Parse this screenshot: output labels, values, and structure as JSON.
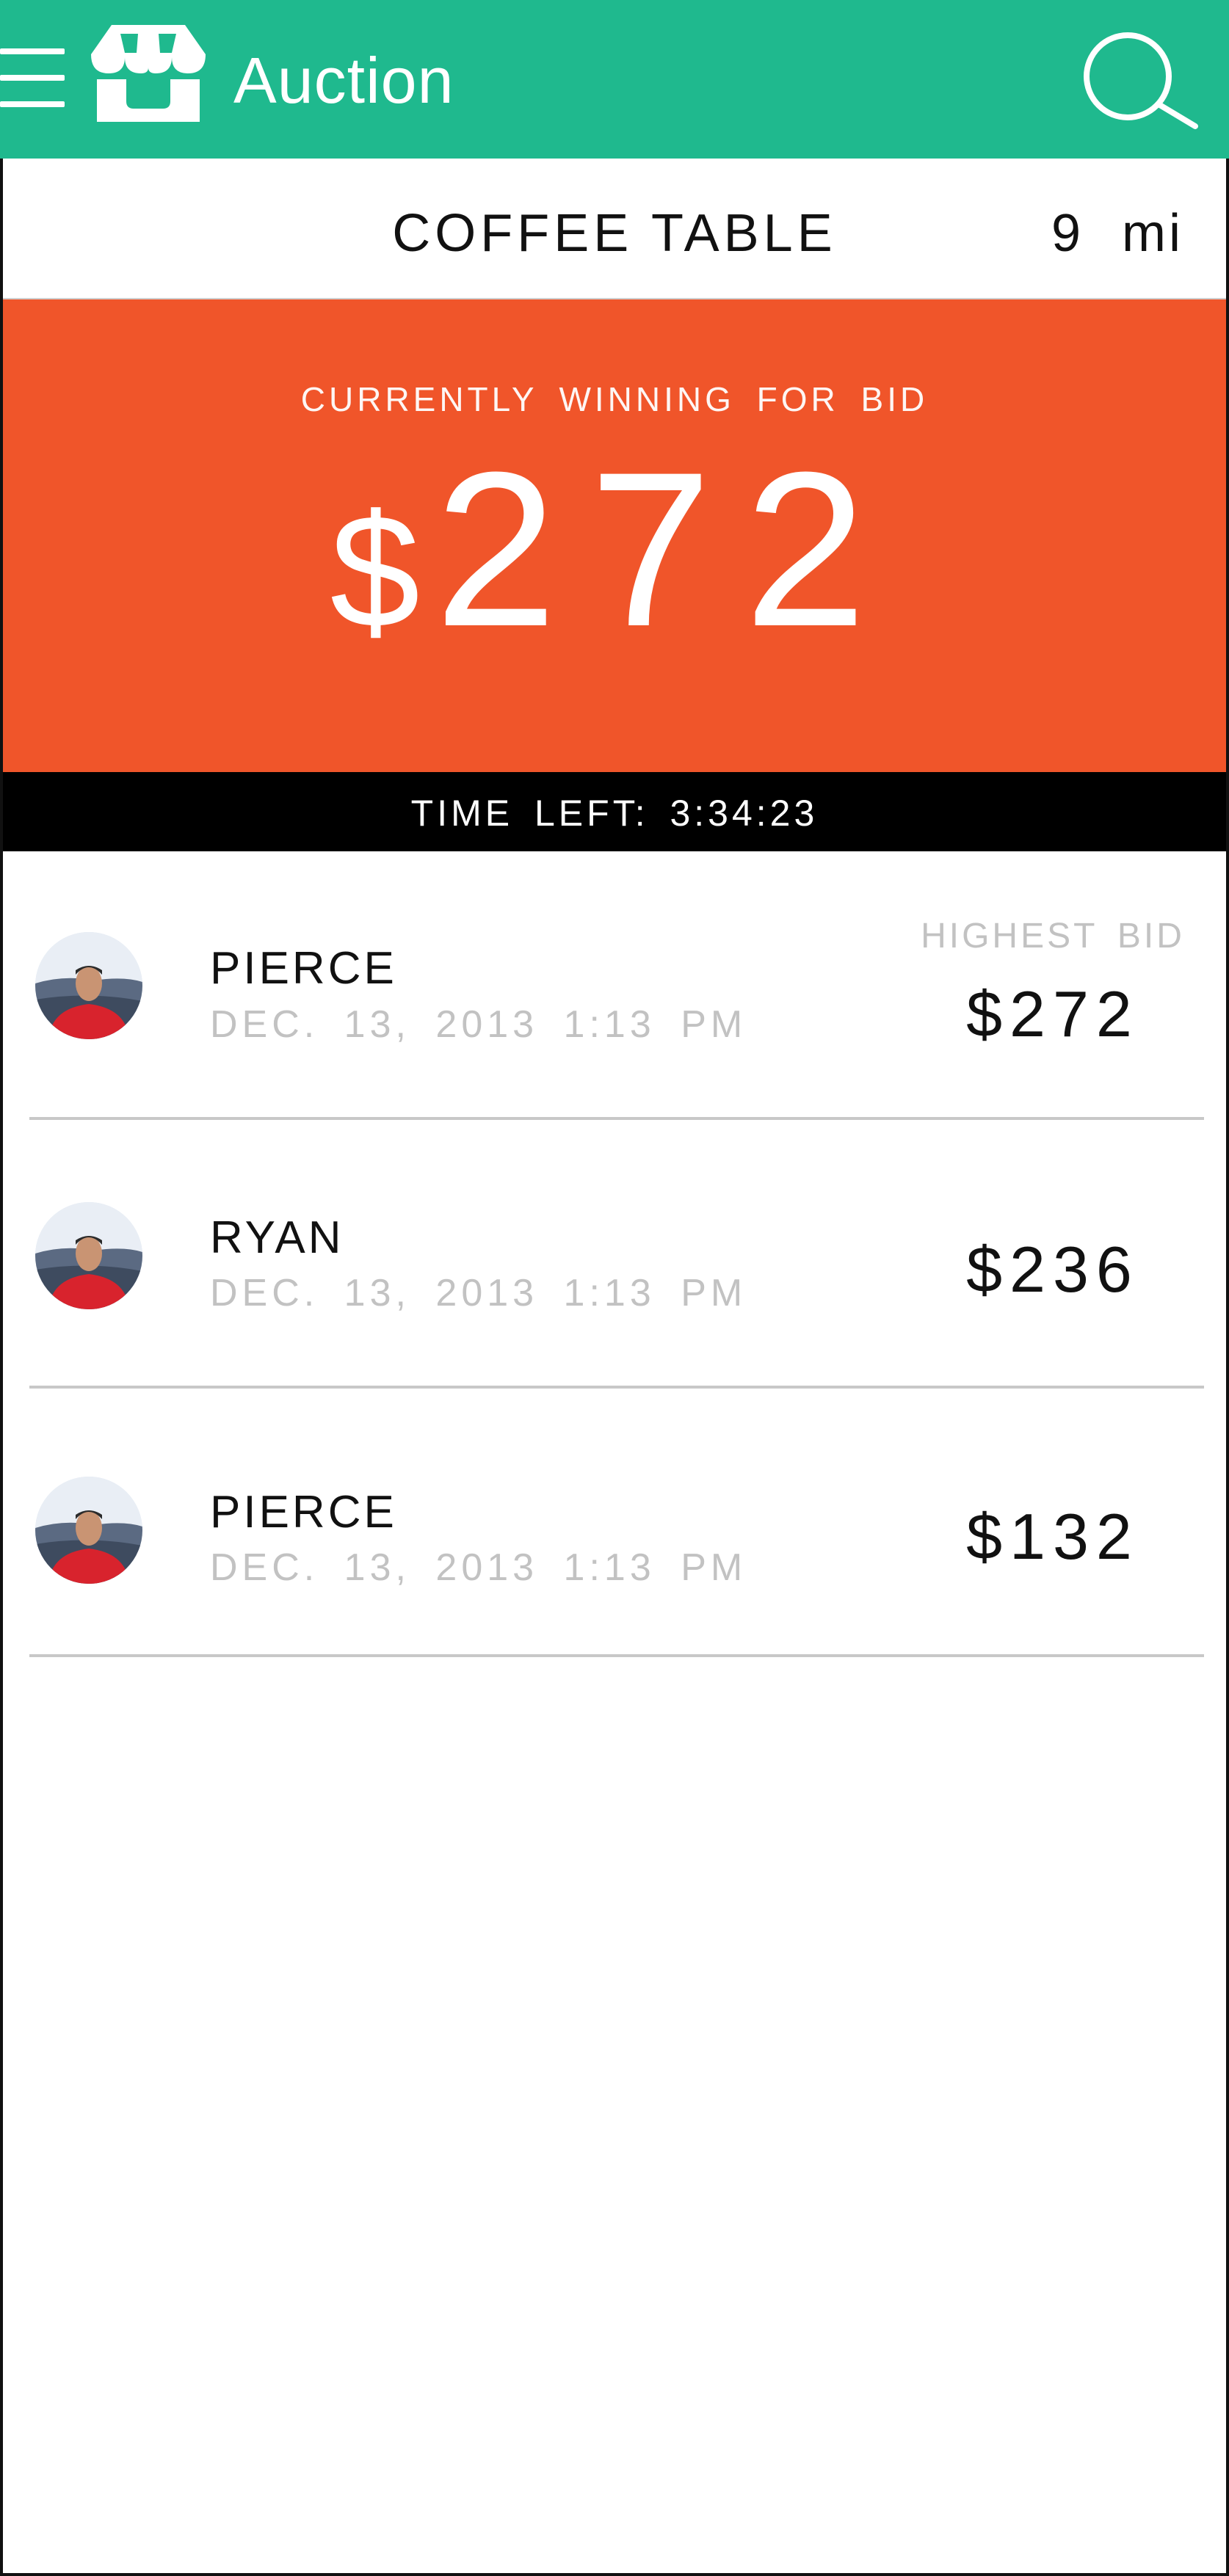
{
  "colors": {
    "appbar": "#1fb98e",
    "banner": "#f0552a",
    "timer_bar": "#000000",
    "muted_text": "#c2c2c2",
    "divider": "#c8c8c8"
  },
  "appbar": {
    "menu_icon": "hamburger-menu-icon",
    "logo_icon": "storefront-icon",
    "title": "Auction",
    "search_icon": "search-icon"
  },
  "item": {
    "title": "COFFEE  TABLE",
    "distance": "9 mi"
  },
  "banner": {
    "caption": "CURRENTLY WINNING FOR BID",
    "currency": "$",
    "amount": "272"
  },
  "timer": {
    "text": "TIME LEFT: 3:34:23"
  },
  "bids": {
    "highest_label": "HIGHEST BID",
    "items": [
      {
        "name": "PIERCE",
        "date": "DEC. 13, 2013 1:13 PM",
        "amount": "$272"
      },
      {
        "name": "RYAN",
        "date": "DEC. 13, 2013 1:13 PM",
        "amount": "$236"
      },
      {
        "name": "PIERCE",
        "date": "DEC. 13, 2013 1:13 PM",
        "amount": "$132"
      }
    ]
  }
}
